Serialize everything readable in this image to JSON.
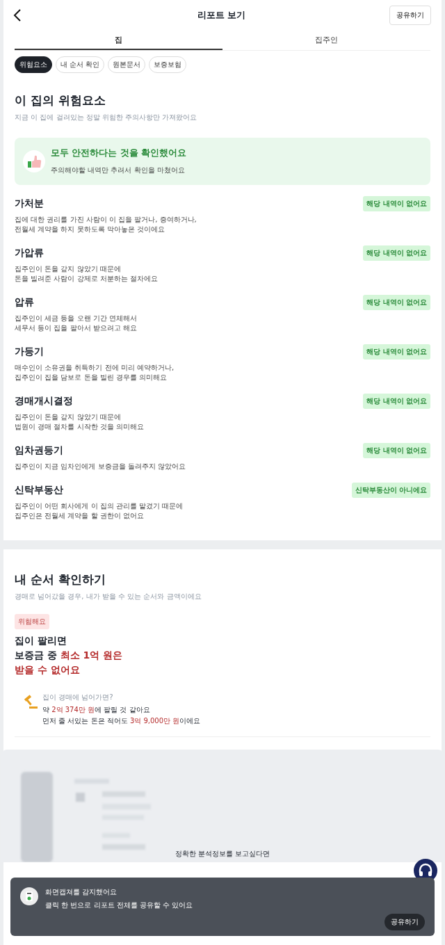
{
  "header": {
    "title": "리포트 보기",
    "share_button": "공유하기"
  },
  "tabs": [
    {
      "label": "집",
      "selected": true
    },
    {
      "label": "집주인",
      "selected": false
    }
  ],
  "chips": [
    {
      "label": "위험요소",
      "selected": true
    },
    {
      "label": "내 순서 확인",
      "selected": false
    },
    {
      "label": "원본문서",
      "selected": false
    },
    {
      "label": "보증보험",
      "selected": false
    }
  ],
  "risk_section": {
    "title": "이 집의 위험요소",
    "subtitle": "지금 이 집에 걸려있는 정말 위험한 주의사항만 가져왔어요",
    "summary": {
      "title": "모두 안전하다는 것을 확인했어요",
      "text": "주의해야할 내역만 추려서 확인을 마쳤어요"
    },
    "items": [
      {
        "name": "가처분",
        "lines": [
          "집에 대한 권리를 가진 사람이 이 집을 팔거나, 증여하거나,",
          "전월세 계약을 하지 못하도록 막아놓은 것이에요"
        ],
        "status": "해당 내역이 없어요"
      },
      {
        "name": "가압류",
        "lines": [
          "집주인이 돈을 갚지 않았기 때문에",
          "돈을 빌려준 사람이 강제로 처분하는 절차에요"
        ],
        "status": "해당 내역이 없어요"
      },
      {
        "name": "압류",
        "lines": [
          "집주인이 세금 등을 오랜 기간 연체해서",
          "세무서 등이 집을 팔아서 받으려고 해요"
        ],
        "status": "해당 내역이 없어요"
      },
      {
        "name": "가등기",
        "lines": [
          "매수인이 소유권을 취득하기 전에 미리 예약하거나,",
          "집주인이 집을 담보로 돈을 빌린 경우를 의미해요"
        ],
        "status": "해당 내역이 없어요"
      },
      {
        "name": "경매개시결정",
        "lines": [
          "집주인이 돈을 갚지 않았기 때문에",
          "법원이 경매 절차를 시작한 것을 의미해요"
        ],
        "status": "해당 내역이 없어요"
      },
      {
        "name": "임차권등기",
        "lines": [
          "집주인이 지금 임차인에게 보증금을 돌려주지 않았어요"
        ],
        "status": "해당 내역이 없어요"
      },
      {
        "name": "신탁부동산",
        "lines": [
          "집주인이 어떤 회사에게 이 집의 관리를 맡겼기 때문에",
          "집주인은 전월세 계약을 할 권한이 없어요"
        ],
        "status": "신탁부동산이 아니에요"
      }
    ]
  },
  "order_section": {
    "title": "내 순서 확인하기",
    "subtitle": "경매로 넘어갔을 경우, 내가 받을 수 있는 순서와 금액이에요",
    "badge": "위험해요",
    "headline": [
      [
        {
          "text": "집이 팔리면",
          "emphasis": false
        }
      ],
      [
        {
          "text": "보증금 중 ",
          "emphasis": false
        },
        {
          "text": "최소 1억 원은",
          "emphasis": true
        }
      ],
      [
        {
          "text": "받을 수 없어요",
          "emphasis": true
        }
      ]
    ],
    "auction": {
      "caption": "집이 경매에 넘어가면?",
      "lines": [
        [
          {
            "text": "약 ",
            "emphasis": false
          },
          {
            "text": "2억 374만 원",
            "emphasis": true
          },
          {
            "text": "에 팔릴 것 같아요",
            "emphasis": false
          }
        ],
        [
          {
            "text": "먼저 줄 서있는 돈은 적어도 ",
            "emphasis": false
          },
          {
            "text": "3억 9,000만 원",
            "emphasis": true
          },
          {
            "text": "이에요",
            "emphasis": false
          }
        ]
      ]
    }
  },
  "locked_preview": {
    "message": "정확한 분석정보를 보고싶다면"
  },
  "toast": {
    "title": "화면캡쳐를 감지했어요",
    "text": "클릭 한 번으로 리포트 전체를 공유할 수 있어요",
    "button": "공유하기"
  }
}
